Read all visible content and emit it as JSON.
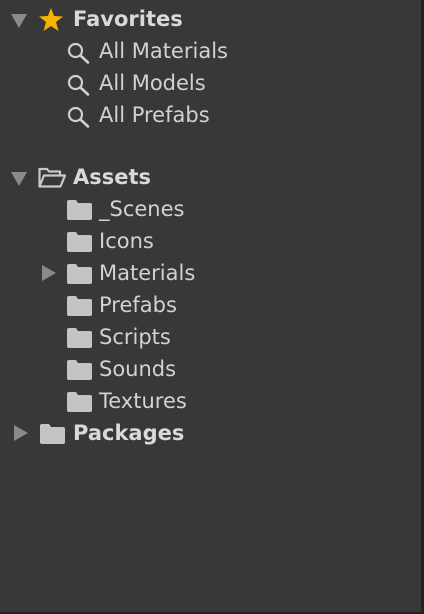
{
  "favorites": {
    "label": "Favorites",
    "icon": "star-icon",
    "expanded": true,
    "items": [
      {
        "label": "All Materials",
        "icon": "search-icon"
      },
      {
        "label": "All Models",
        "icon": "search-icon"
      },
      {
        "label": "All Prefabs",
        "icon": "search-icon"
      }
    ]
  },
  "assets": {
    "label": "Assets",
    "icon": "folder-open-icon",
    "expanded": true,
    "items": [
      {
        "label": "_Scenes",
        "icon": "folder-icon",
        "has_children": false
      },
      {
        "label": "Icons",
        "icon": "folder-icon",
        "has_children": false
      },
      {
        "label": "Materials",
        "icon": "folder-icon",
        "has_children": true
      },
      {
        "label": "Prefabs",
        "icon": "folder-icon",
        "has_children": false
      },
      {
        "label": "Scripts",
        "icon": "folder-icon",
        "has_children": false
      },
      {
        "label": "Sounds",
        "icon": "folder-icon",
        "has_children": false
      },
      {
        "label": "Textures",
        "icon": "folder-icon",
        "has_children": false
      }
    ]
  },
  "packages": {
    "label": "Packages",
    "icon": "folder-icon",
    "expanded": false
  },
  "colors": {
    "background": "#383838",
    "text": "#d2d2d2",
    "caret": "#8a8a8a",
    "star": "#f5b400",
    "folder": "#c4c4c4"
  }
}
